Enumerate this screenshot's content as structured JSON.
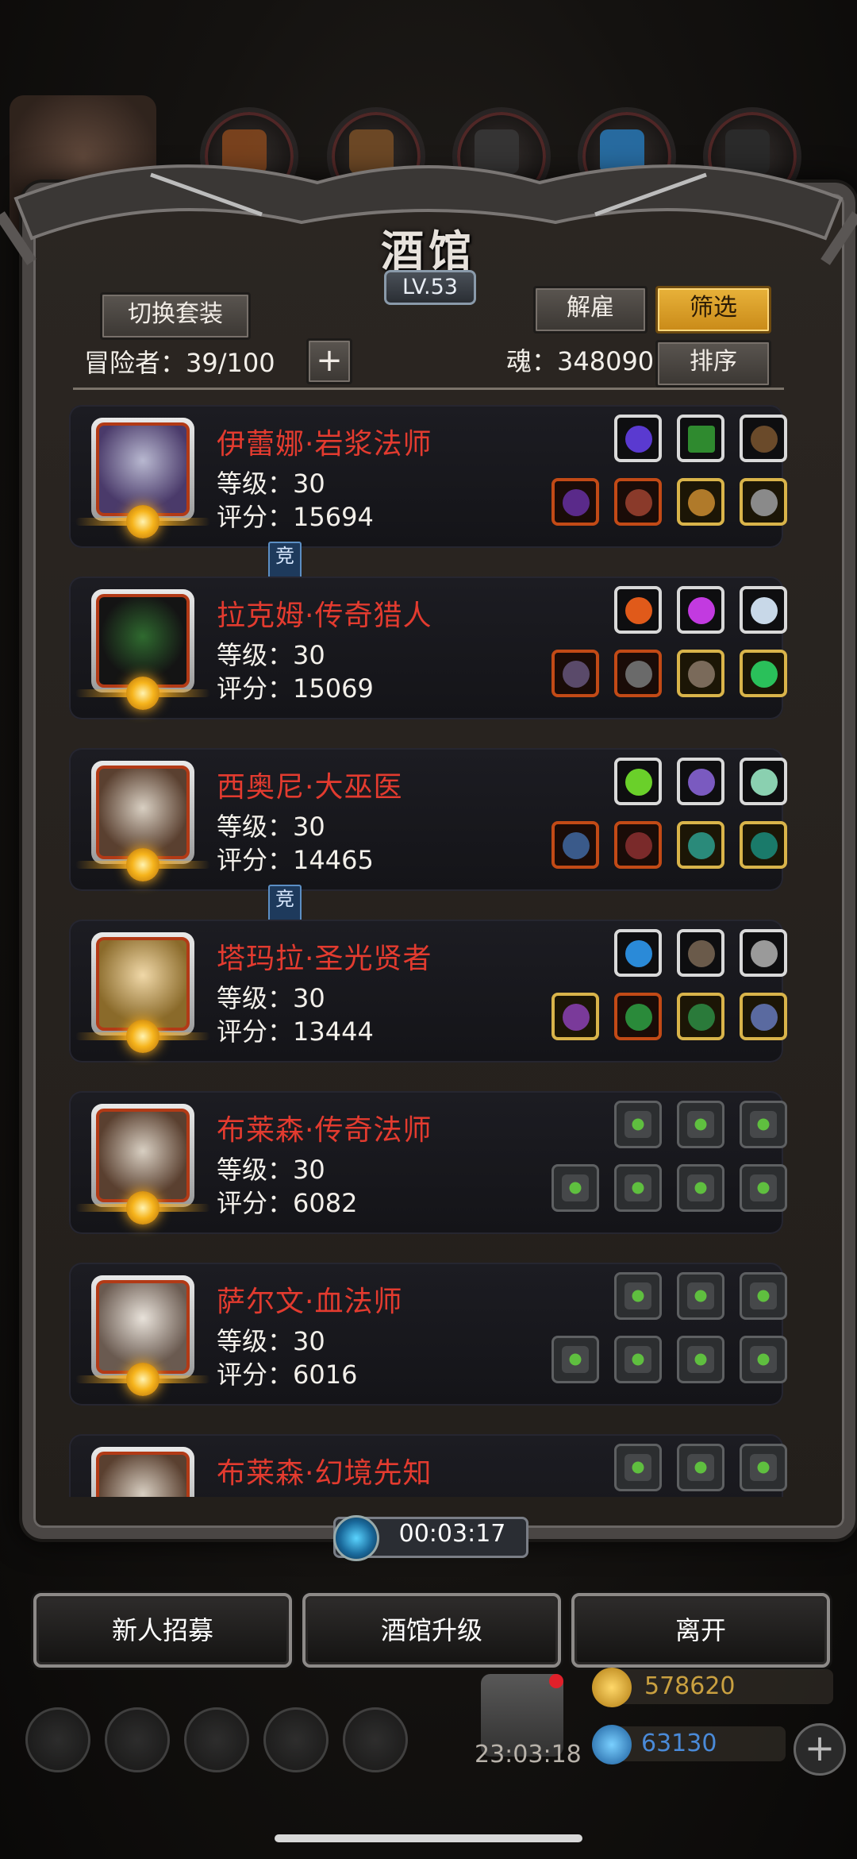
{
  "dialog": {
    "title": "酒馆",
    "level": "LV.53",
    "switch_outfit_label": "切换套装",
    "dismiss_label": "解雇",
    "filter_label": "筛选",
    "sort_label": "排序",
    "adventurers_label": "冒险者：39/100",
    "soul_label": "魂：348090",
    "plus_label": "+",
    "competition_tag": "竞"
  },
  "heroes": [
    {
      "name": "伊蕾娜·岩浆法师",
      "level": "等级：30",
      "score": "评分：15694",
      "competition": true,
      "top_slots": [
        "silver",
        "silver",
        "silver"
      ],
      "bottom_slots": [
        "red",
        "red",
        "gold",
        "gold"
      ]
    },
    {
      "name": "拉克姆·传奇猎人",
      "level": "等级：30",
      "score": "评分：15069",
      "competition": false,
      "top_slots": [
        "silver",
        "silver",
        "silver"
      ],
      "bottom_slots": [
        "red",
        "red",
        "gold",
        "gold"
      ]
    },
    {
      "name": "西奥尼·大巫医",
      "level": "等级：30",
      "score": "评分：14465",
      "competition": true,
      "top_slots": [
        "silver",
        "silver",
        "silver"
      ],
      "bottom_slots": [
        "red",
        "red",
        "gold",
        "gold"
      ]
    },
    {
      "name": "塔玛拉·圣光贤者",
      "level": "等级：30",
      "score": "评分：13444",
      "competition": false,
      "top_slots": [
        "silver",
        "silver",
        "silver"
      ],
      "bottom_slots": [
        "gold",
        "red",
        "gold",
        "gold"
      ]
    },
    {
      "name": "布莱森·传奇法师",
      "level": "等级：30",
      "score": "评分：6082",
      "competition": false,
      "top_slots": [
        "empty",
        "empty",
        "empty"
      ],
      "bottom_slots": [
        "empty",
        "empty",
        "empty",
        "empty"
      ]
    },
    {
      "name": "萨尔文·血法师",
      "level": "等级：30",
      "score": "评分：6016",
      "competition": false,
      "top_slots": [
        "empty",
        "empty",
        "empty"
      ],
      "bottom_slots": [
        "empty",
        "empty",
        "empty",
        "empty"
      ]
    },
    {
      "name": "布莱森·幻境先知",
      "level": "",
      "score": "",
      "competition": false,
      "top_slots": [
        "empty",
        "empty",
        "empty"
      ],
      "bottom_slots": []
    }
  ],
  "timer": "00:03:17",
  "bottom_buttons": {
    "recruit": "新人招募",
    "upgrade": "酒馆升级",
    "leave": "离开"
  },
  "background": {
    "gift_timer": "23:03:18",
    "gold": "578620",
    "gems": "63130"
  },
  "colors": {
    "hero_name": "#e33b2f",
    "gold_button": "#e0a52a",
    "slot_gold": "#d9b44a",
    "slot_red": "#c24a16"
  }
}
